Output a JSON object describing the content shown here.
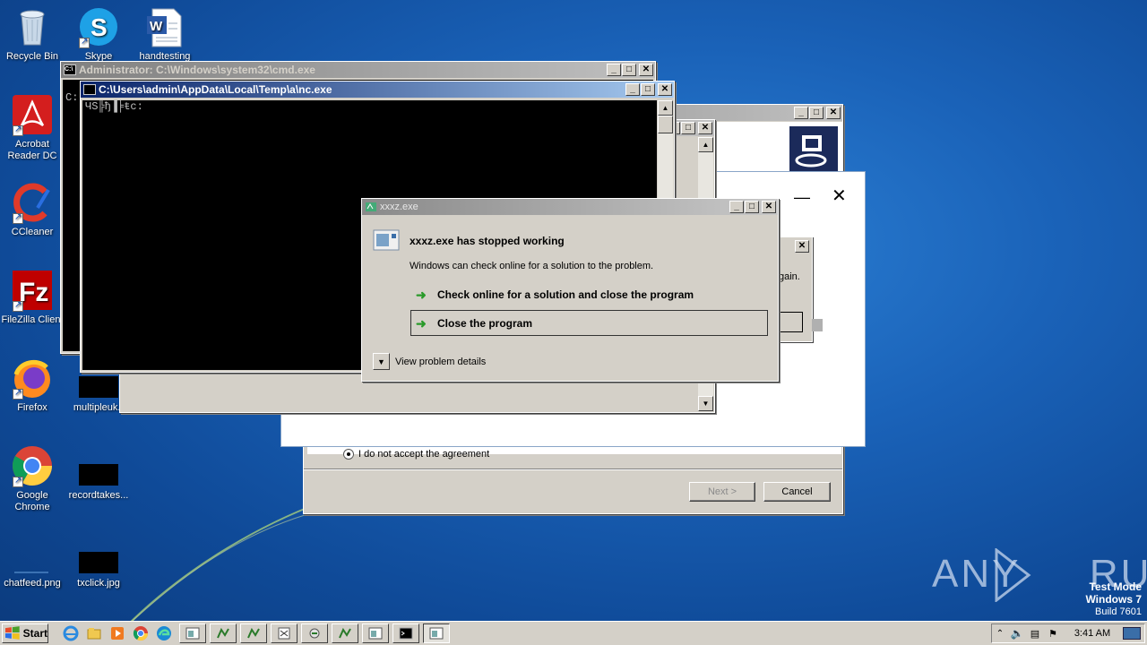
{
  "desktop": {
    "icons": [
      {
        "label": "Recycle Bin",
        "icon": "recycle-bin-icon"
      },
      {
        "label": "Skype",
        "icon": "skype-icon"
      },
      {
        "label": "handtesting",
        "icon": "word-document-icon"
      },
      {
        "label": "Acrobat Reader DC",
        "icon": "acrobat-icon"
      },
      {
        "label": "CCleaner",
        "icon": "ccleaner-icon"
      },
      {
        "label": "FileZilla Client",
        "icon": "filezilla-icon"
      },
      {
        "label": "Firefox",
        "icon": "firefox-icon"
      },
      {
        "label": "multipleuk.r",
        "icon": "black-thumbnail-icon"
      },
      {
        "label": "Google Chrome",
        "icon": "chrome-icon"
      },
      {
        "label": "recordtakes...",
        "icon": "black-thumbnail-icon"
      },
      {
        "label": "chatfeed.png",
        "icon": "image-file-icon"
      },
      {
        "label": "txclick.jpg",
        "icon": "black-thumbnail-icon"
      }
    ],
    "watermark": {
      "logo_text": "ANY RUN",
      "line1": "Test Mode",
      "line2": "Windows 7",
      "line3": "Build 7601"
    }
  },
  "cmd_window": {
    "title": "Administrator: C:\\Windows\\system32\\cmd.exe",
    "prompt_visible": "C:"
  },
  "nc_window": {
    "title": "C:\\Users\\admin\\AppData\\Local\\Temp\\a\\nc.exe",
    "console_text": "ЧЅ╠ђ▐╞ŧc:"
  },
  "installer_window": {
    "radio_label": "I do not accept the agreement",
    "next_label": "Next >",
    "cancel_label": "Cancel",
    "message_fragment": "gain."
  },
  "error_dialog": {
    "title": "xxxz.exe",
    "heading": "xxxz.exe has stopped working",
    "message": "Windows can check online for a solution to the problem.",
    "option1": "Check online for a solution and close the program",
    "option2": "Close the program",
    "details": "View problem details"
  },
  "taskbar": {
    "start_label": "Start",
    "time": "3:41 AM"
  },
  "colors": {
    "title_active": "#0a246a",
    "title_inactive": "#808080",
    "desktop_blue": "#1a62b8"
  }
}
